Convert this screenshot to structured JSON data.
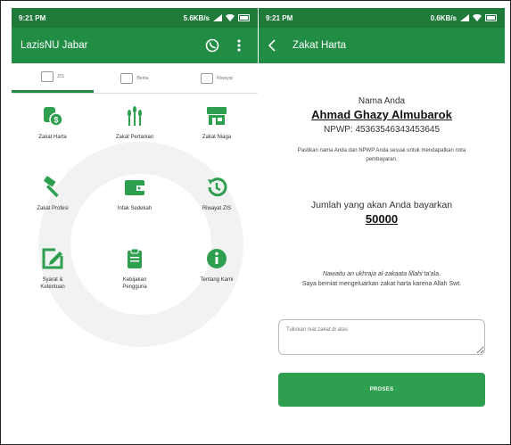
{
  "left_screen": {
    "status": {
      "time": "9:21 PM",
      "speed": "5.6KB/s"
    },
    "appbar": {
      "title": "LazisNU Jabar",
      "whatsapp_icon": "whatsapp-icon",
      "more_icon": "more-vert-icon"
    },
    "tabs": [
      {
        "label": "ZIS",
        "active": true
      },
      {
        "label": "Berita",
        "active": false
      },
      {
        "label": "Riwayat",
        "active": false
      }
    ],
    "menu": [
      {
        "label": "Zakat Harta",
        "icon": "money-bag-icon"
      },
      {
        "label": "Zakat Pertanian",
        "icon": "wheat-icon"
      },
      {
        "label": "Zakat Niaga",
        "icon": "store-icon"
      },
      {
        "label": "Zakat Profesi",
        "icon": "hammer-icon"
      },
      {
        "label": "Infak Sedekah",
        "icon": "wallet-icon"
      },
      {
        "label": "Riwayat ZIS",
        "icon": "history-icon"
      },
      {
        "label": "Syarat &\nKetentuan",
        "icon": "edit-icon"
      },
      {
        "label": "Kebijakan\nPengguna",
        "icon": "clipboard-icon"
      },
      {
        "label": "Tentang Kami",
        "icon": "info-icon"
      }
    ],
    "colors": {
      "primary": "#218c44",
      "icon_green": "#2e9e4f"
    }
  },
  "right_screen": {
    "status": {
      "time": "9:21 PM",
      "speed": "0.6KB/s"
    },
    "appbar": {
      "title": "Zakat Harta"
    },
    "name_label": "Nama Anda",
    "name_value": "Ahmad Ghazy Almubarok",
    "npwp_value": "NPWP: 45363546343453645",
    "confirm_note": "Pastikan nama Anda dan NPWP Anda sesuai untuk mendapatkan nota pembayaran.",
    "amount_label": "Jumlah yang akan Anda bayarkan",
    "amount_value": "50000",
    "niat_arabic": "Nawaitu an ukhraja al-zakaata lillahi",
    "niat_suffix": " ta'ala.",
    "niat_text": "Saya berniat mengeluarkan zakat harta karena Allah Swt.",
    "niat_placeholder": "Tuliskan niat zakat di atas",
    "proses_label": "PROSES"
  }
}
